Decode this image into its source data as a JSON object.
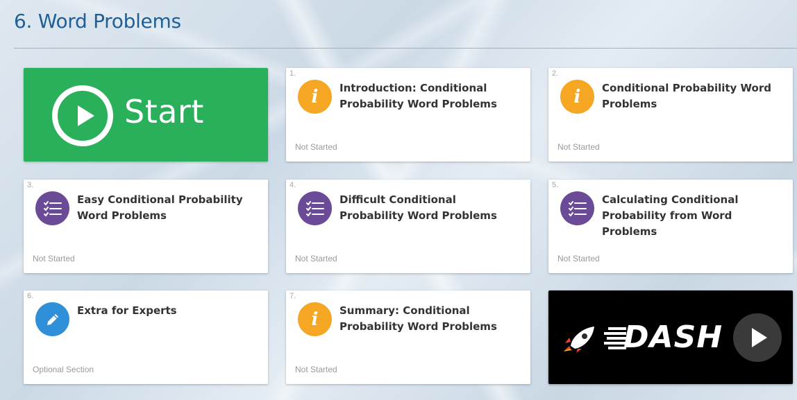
{
  "section": {
    "title": "6. Word Problems"
  },
  "start_card": {
    "label": "Start",
    "color": "#2aaf5a"
  },
  "cards": [
    {
      "number": "1.",
      "title": "Introduction: Conditional Probability Word Problems",
      "status": "Not Started",
      "icon": "info-icon"
    },
    {
      "number": "2.",
      "title": "Conditional Probability Word Problems",
      "status": "Not Started",
      "icon": "info-icon"
    },
    {
      "number": "3.",
      "title": "Easy Conditional Probability Word Problems",
      "status": "Not Started",
      "icon": "quiz-list-icon"
    },
    {
      "number": "4.",
      "title": "Difficult Conditional Probability Word Problems",
      "status": "Not Started",
      "icon": "quiz-list-icon"
    },
    {
      "number": "5.",
      "title": "Calculating Conditional Probability from Word Problems",
      "status": "Not Started",
      "icon": "quiz-list-icon"
    },
    {
      "number": "6.",
      "title": "Extra for Experts",
      "status": "Optional Section",
      "icon": "pencil-icon"
    },
    {
      "number": "7.",
      "title": "Summary: Conditional Probability Word Problems",
      "status": "Not Started",
      "icon": "info-icon"
    }
  ],
  "dash_card": {
    "label": "DASH",
    "icon": "rocket-icon"
  },
  "colors": {
    "heading": "#1f5f96",
    "info": "#f5a623",
    "quiz": "#6b4a97",
    "edit": "#2f8fd8"
  }
}
